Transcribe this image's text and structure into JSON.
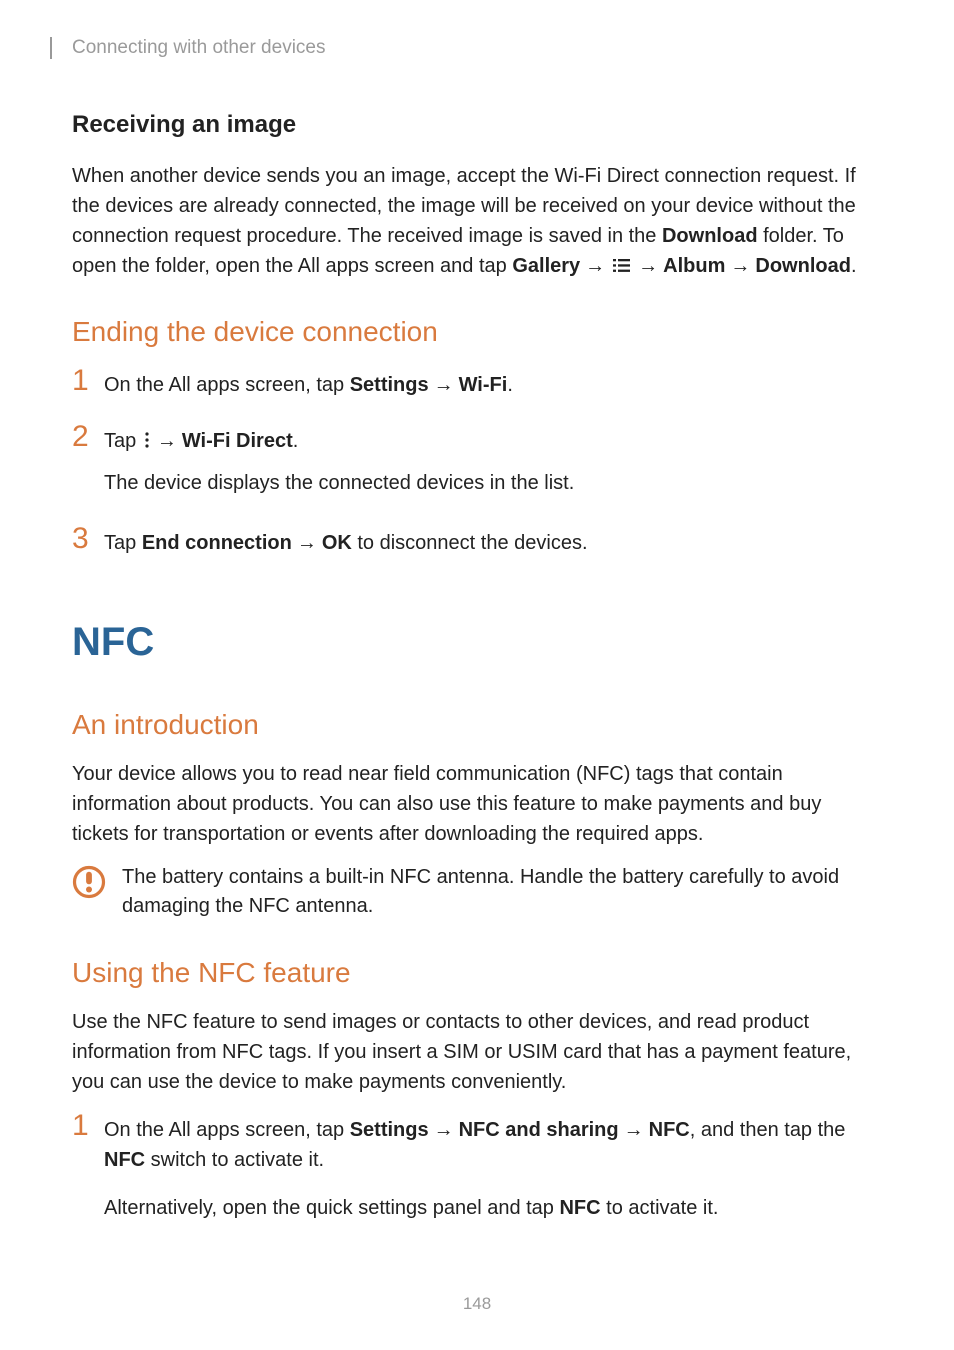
{
  "header": {
    "breadcrumb": "Connecting with other devices"
  },
  "section1": {
    "title": "Receiving an image",
    "para_a": "When another device sends you an image, accept the Wi-Fi Direct connection request. If the devices are already connected, the image will be received on your device without the connection request procedure. The received image is saved in the ",
    "bold_download": "Download",
    "para_b": " folder. To open the folder, open the All apps screen and tap ",
    "bold_gallery": "Gallery",
    "bold_album": "Album",
    "bold_download2": "Download",
    "period": "."
  },
  "section2": {
    "title": "Ending the device connection",
    "step1": {
      "num": "1",
      "a": "On the All apps screen, tap ",
      "settings": "Settings",
      "wifi": "Wi-Fi",
      "end": "."
    },
    "step2": {
      "num": "2",
      "a": "Tap ",
      "wifidirect": "Wi-Fi Direct",
      "end": ".",
      "sub": "The device displays the connected devices in the list."
    },
    "step3": {
      "num": "3",
      "a": "Tap ",
      "endconn": "End connection",
      "ok": "OK",
      "tail": " to disconnect the devices."
    }
  },
  "section3": {
    "title": "NFC",
    "sub1": {
      "title": "An introduction",
      "para": "Your device allows you to read near field communication (NFC) tags that contain information about products. You can also use this feature to make payments and buy tickets for transportation or events after downloading the required apps.",
      "notice": "The battery contains a built-in NFC antenna. Handle the battery carefully to avoid damaging the NFC antenna."
    },
    "sub2": {
      "title": "Using the NFC feature",
      "para": "Use the NFC feature to send images or contacts to other devices, and read product information from NFC tags. If you insert a SIM or USIM card that has a payment feature, you can use the device to make payments conveniently.",
      "step1": {
        "num": "1",
        "a": "On the All apps screen, tap ",
        "settings": "Settings",
        "nfcshare": "NFC and sharing",
        "nfc": "NFC",
        "mid": ", and then tap the ",
        "nfc2": "NFC",
        "tail": " switch to activate it.",
        "sub_a": "Alternatively, open the quick settings panel and tap ",
        "sub_nfc": "NFC",
        "sub_b": " to activate it."
      }
    }
  },
  "page_number": "148"
}
